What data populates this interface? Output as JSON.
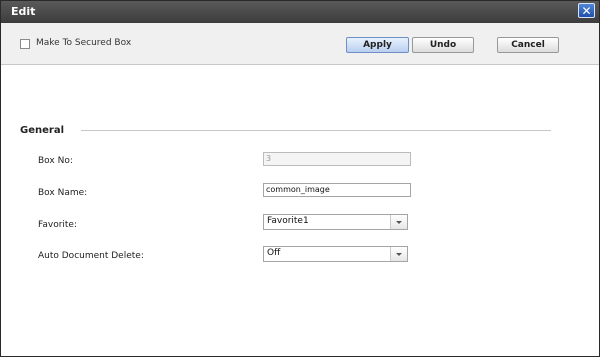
{
  "window": {
    "title": "Edit",
    "close_icon": "close-icon"
  },
  "toolbar": {
    "secured_checkbox_label": "Make To Secured Box",
    "secured_checked": false,
    "apply_label": "Apply",
    "undo_label": "Undo",
    "cancel_label": "Cancel"
  },
  "general": {
    "section_title": "General",
    "box_no": {
      "label": "Box No:",
      "value": "3"
    },
    "box_name": {
      "label": "Box Name:",
      "value": "common_image"
    },
    "favorite": {
      "label": "Favorite:",
      "selected": "Favorite1"
    },
    "auto_delete": {
      "label": "Auto Document Delete:",
      "selected": "Off"
    }
  },
  "colors": {
    "titlebar": "#3c3c3c",
    "apply_button": "#b9cff0",
    "close_button": "#1f4fa8"
  }
}
